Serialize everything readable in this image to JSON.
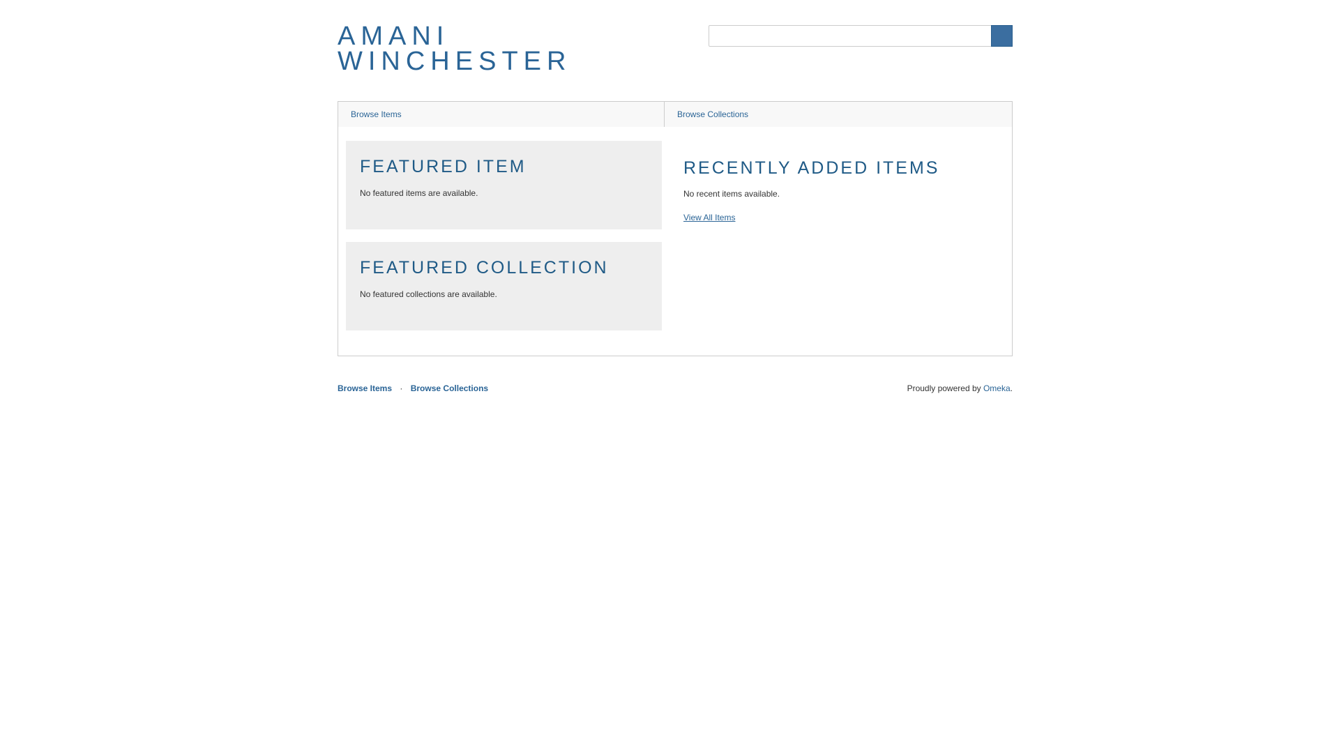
{
  "header": {
    "site_title_line1": "AMANI",
    "site_title_line2": "WINCHESTER",
    "search": {
      "value": "",
      "placeholder": "",
      "submit_icon": "search-icon"
    }
  },
  "nav": {
    "items": [
      {
        "label": "Browse Items"
      },
      {
        "label": "Browse Collections"
      }
    ]
  },
  "featured_item": {
    "heading": "FEATURED ITEM",
    "empty_text": "No featured items are available."
  },
  "featured_collection": {
    "heading": "FEATURED COLLECTION",
    "empty_text": "No featured collections are available."
  },
  "recent_items": {
    "heading": "RECENTLY ADDED ITEMS",
    "empty_text": "No recent items available.",
    "view_all_label": "View All Items"
  },
  "footer": {
    "nav": [
      {
        "label": "Browse Items"
      },
      {
        "label": "Browse Collections"
      }
    ],
    "separator": "·",
    "powered_prefix": "Proudly powered by ",
    "powered_link": "Omeka",
    "powered_suffix": "."
  },
  "colors": {
    "link": "#2a6496",
    "heading": "#1f5a86",
    "search_button": "#3b6ea0",
    "panel_background": "#eeeeee",
    "border": "#cccccc"
  }
}
